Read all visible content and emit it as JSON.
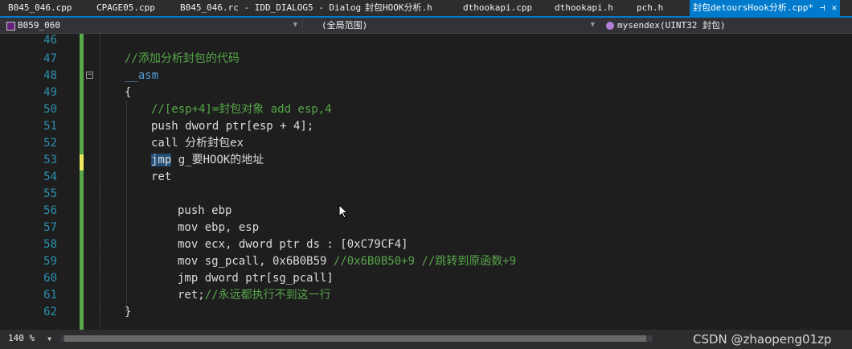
{
  "tabs": [
    {
      "label": "B045_046.cpp"
    },
    {
      "label": "CPAGE05.cpp"
    },
    {
      "label": "B045_046.rc - IDD_DIALOG5 - Dialog"
    },
    {
      "label": "封包HOOK分析.h"
    },
    {
      "label": "dthookapi.cpp"
    },
    {
      "label": "dthookapi.h"
    },
    {
      "label": "pch.h"
    },
    {
      "label": "封包detoursHook分析.cpp*",
      "active": true
    }
  ],
  "nav": {
    "project": "B059_060",
    "scope": "(全局范围)",
    "function": "mysendex(UINT32 封包)"
  },
  "code_lines": [
    {
      "n": "46",
      "text": ""
    },
    {
      "n": "47",
      "text": "//添加分析封包的代码"
    },
    {
      "n": "48",
      "text": "__asm"
    },
    {
      "n": "49",
      "text": "{"
    },
    {
      "n": "50",
      "text": "//[esp+4]=封包对象 add esp,4"
    },
    {
      "n": "51",
      "text": "push dword ptr[esp + 4];"
    },
    {
      "n": "52",
      "text": "call 分析封包ex"
    },
    {
      "n": "53",
      "text_hl": "jmp",
      "text": " g_要HOOK的地址"
    },
    {
      "n": "54",
      "text": "ret"
    },
    {
      "n": "55",
      "text": ""
    },
    {
      "n": "56",
      "text": "push ebp"
    },
    {
      "n": "57",
      "text": "mov ebp, esp"
    },
    {
      "n": "58",
      "text": "mov ecx, dword ptr ds : [0xC79CF4]"
    },
    {
      "n": "59",
      "text": "mov sg_pcall, 0x6B0B59 ",
      "comment": "//0x6B0B50+9 //跳转到原函数+9"
    },
    {
      "n": "60",
      "text": "jmp dword ptr[sg_pcall]"
    },
    {
      "n": "61",
      "text": "ret;",
      "comment": "//永远都执行不到这一行"
    },
    {
      "n": "62",
      "text": "}"
    }
  ],
  "status": {
    "zoom": "140 %",
    "watermark": "CSDN @zhaopeng01zp"
  },
  "icons": {
    "pin": "pin-icon",
    "close": "close-icon",
    "dropdown": "chevron-down-icon",
    "cursor": "mouse-pointer-icon"
  },
  "colors": {
    "accent": "#007acc",
    "comment": "#57a64a",
    "keyword": "#569cd6",
    "line_number": "#2b91af",
    "change_marker": "#57a64a",
    "unsaved_marker": "#efe85a"
  }
}
